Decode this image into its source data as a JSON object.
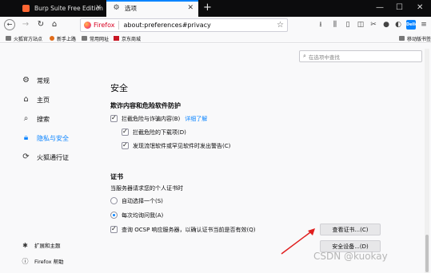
{
  "tabs": [
    {
      "title": "Burp Suite Free Edition",
      "icon": "burp-icon"
    },
    {
      "title": "选项",
      "icon": "gear-icon"
    }
  ],
  "url": {
    "brand": "Firefox",
    "address": "about:preferences#privacy"
  },
  "toolbar_badge": "Dello",
  "bookmarks": [
    {
      "label": "火狐官方站点",
      "icon": "folder-icon"
    },
    {
      "label": "新手上路",
      "icon": "firefox-icon"
    },
    {
      "label": "常用网址",
      "icon": "folder-icon"
    },
    {
      "label": "京东商城",
      "icon": "jd-icon"
    }
  ],
  "mobile_bookmarks": "移动版书签",
  "search_placeholder": "在选项中查找",
  "sidebar": {
    "items": [
      {
        "label": "常规",
        "icon": "gear-icon"
      },
      {
        "label": "主页",
        "icon": "home-icon"
      },
      {
        "label": "搜索",
        "icon": "search-icon"
      },
      {
        "label": "隐私与安全",
        "icon": "lock-icon"
      },
      {
        "label": "火狐通行证",
        "icon": "sync-icon"
      }
    ],
    "footer": [
      {
        "label": "扩展和主题",
        "icon": "puzzle-icon"
      },
      {
        "label": "Firefox 帮助",
        "icon": "help-icon"
      }
    ]
  },
  "security": {
    "title": "安全",
    "subtitle": "欺诈内容和危险软件防护",
    "block_label": "拦截危险与诈骗内容(B)",
    "learn_more": "详细了解",
    "block_downloads": "拦截危险的下载项(D)",
    "warn_unwanted": "发现流氓软件或罕见软件时发出警告(C)"
  },
  "certificates": {
    "title": "证书",
    "description": "当服务器请求您的个人证书时",
    "auto_select": "自动选择一个(S)",
    "ask_every_time": "每次均询问我(A)",
    "ocsp_label": "查询 OCSP 响应服务器，以确认证书当前是否有效(Q)",
    "view_button": "查看证书...(C)",
    "devices_button": "安全设备...(D)"
  },
  "watermark": "CSDN @kuokay"
}
